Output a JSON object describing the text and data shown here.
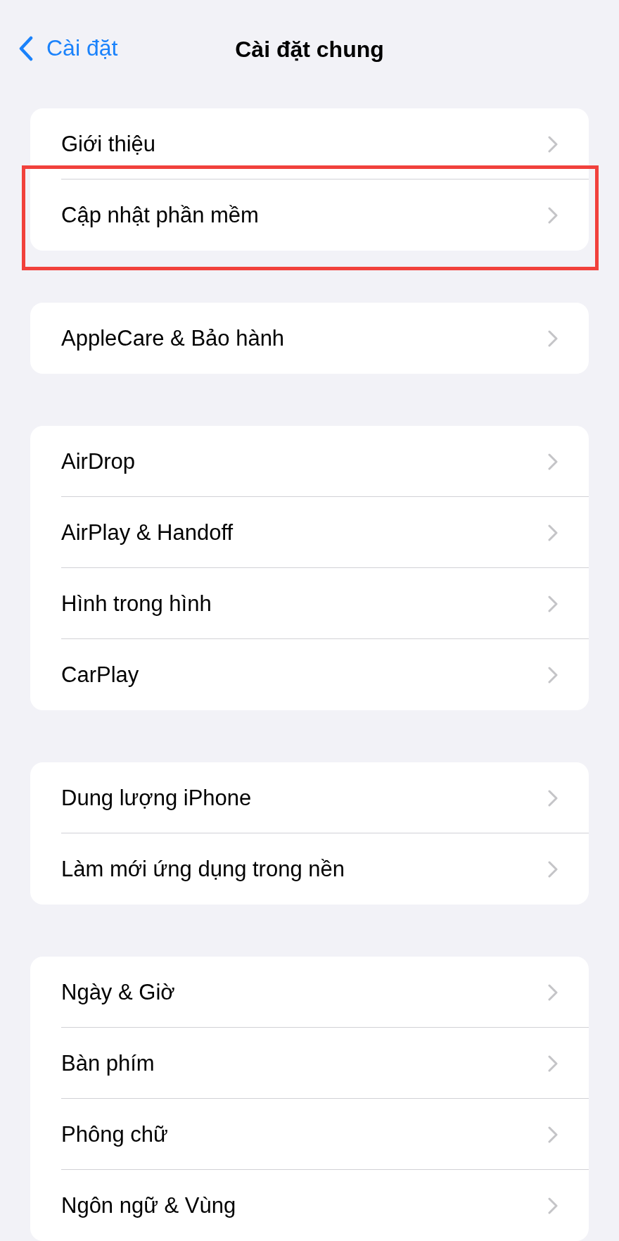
{
  "nav": {
    "back_label": "Cài đặt",
    "title": "Cài đặt chung"
  },
  "groups": [
    {
      "rows": [
        {
          "label": "Giới thiệu",
          "highlighted": false
        },
        {
          "label": "Cập nhật phần mềm",
          "highlighted": true
        }
      ]
    },
    {
      "rows": [
        {
          "label": "AppleCare & Bảo hành",
          "highlighted": false
        }
      ]
    },
    {
      "rows": [
        {
          "label": "AirDrop",
          "highlighted": false
        },
        {
          "label": "AirPlay & Handoff",
          "highlighted": false
        },
        {
          "label": "Hình trong hình",
          "highlighted": false
        },
        {
          "label": "CarPlay",
          "highlighted": false
        }
      ]
    },
    {
      "rows": [
        {
          "label": "Dung lượng iPhone",
          "highlighted": false
        },
        {
          "label": "Làm mới ứng dụng trong nền",
          "highlighted": false
        }
      ]
    },
    {
      "rows": [
        {
          "label": "Ngày & Giờ",
          "highlighted": false
        },
        {
          "label": "Bàn phím",
          "highlighted": false
        },
        {
          "label": "Phông chữ",
          "highlighted": false
        },
        {
          "label": "Ngôn ngữ & Vùng",
          "highlighted": false
        }
      ]
    }
  ]
}
